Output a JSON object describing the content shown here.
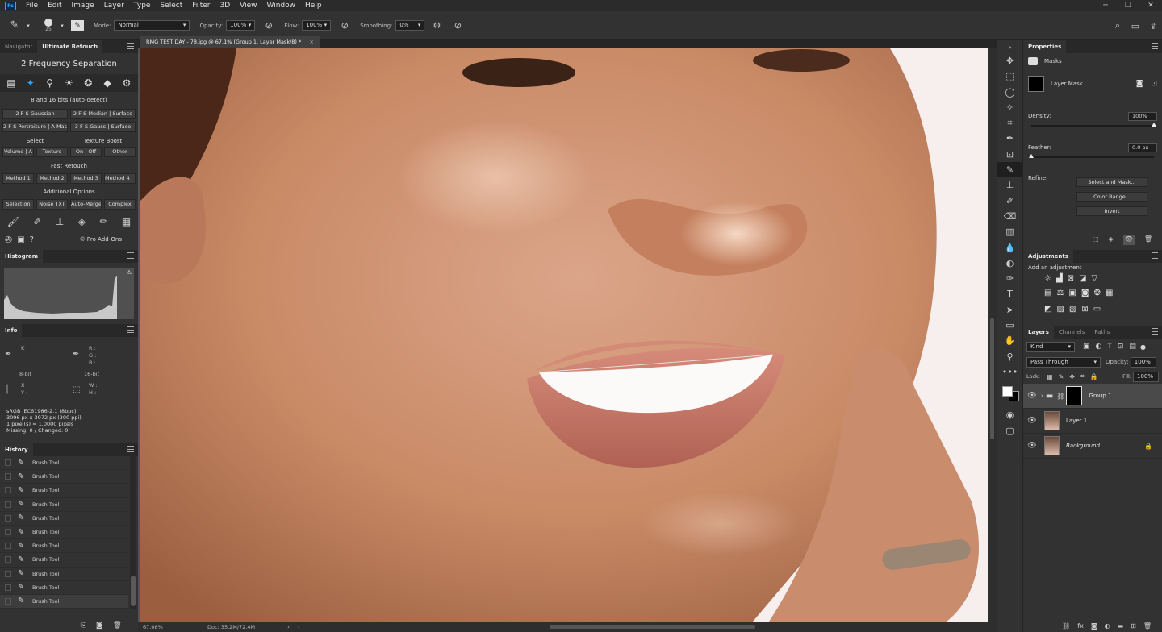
{
  "menubar": {
    "app_icon": "Ps",
    "items": [
      "File",
      "Edit",
      "Image",
      "Layer",
      "Type",
      "Select",
      "Filter",
      "3D",
      "View",
      "Window",
      "Help"
    ]
  },
  "options": {
    "brush_size": "25",
    "mode_label": "Mode:",
    "mode_value": "Normal",
    "opacity_label": "Opacity:",
    "opacity_value": "100%",
    "flow_label": "Flow:",
    "flow_value": "100%",
    "smoothing_label": "Smoothing:",
    "smoothing_value": "0%"
  },
  "left_panel": {
    "tabs": [
      "Navigator",
      "Ultimate Retouch"
    ],
    "ur_title": "2 Frequency Separation",
    "ur_subtitle": "8 and 16 bits (auto-detect)",
    "row1": [
      "2 F-S Gaussian",
      "2 F-S Median | Surface"
    ],
    "row2": [
      "2 F-S Portraiture | A-Mask",
      "3 F-S Gauss | Surface"
    ],
    "heads1": [
      "Select",
      "Texture Boost"
    ],
    "row3": [
      "Volume | A",
      "Texture",
      "On - Off",
      "Other"
    ],
    "head_fast": "Fast Retouch",
    "row4": [
      "Method 1",
      "Method 2",
      "Method 3",
      "Method 4 | A"
    ],
    "head_add": "Additional Options",
    "row5": [
      "Selection",
      "Noise TXT",
      "Auto-Merge",
      "Complex"
    ],
    "pro_addons": "© Pro Add-Ons",
    "histogram_tab": "Histogram",
    "info_tab": "Info",
    "info": {
      "k": "K :",
      "rgb": [
        "R :",
        "G :",
        "B :"
      ],
      "bit8": "8-bit",
      "bit16": "16-bit",
      "xy": [
        "X :",
        "Y :"
      ],
      "wh": [
        "W :",
        "H :"
      ],
      "lines": [
        "sRGB IEC61966-2.1 (8bpc)",
        "3096 px x 3972 px (300 ppi)",
        "1 pixel(s) = 1.0000 pixels",
        "Missing: 0 / Changed: 0"
      ]
    },
    "history_tab": "History",
    "history_items": [
      "Brush Tool",
      "Brush Tool",
      "Brush Tool",
      "Brush Tool",
      "Brush Tool",
      "Brush Tool",
      "Brush Tool",
      "Brush Tool",
      "Brush Tool",
      "Brush Tool",
      "Brush Tool"
    ]
  },
  "document": {
    "tab_title": "RMG TEST DAY - 78.jpg @ 67.1% (Group 1, Layer Mask/8) *",
    "close": "×",
    "zoom": "67.08%",
    "doc_size": "Doc: 35.2M/72.4M"
  },
  "properties": {
    "tab": "Properties",
    "masks_label": "Masks",
    "layer_mask_label": "Layer Mask",
    "density_label": "Density:",
    "density_value": "100%",
    "density_level": 1.0,
    "feather_label": "Feather:",
    "feather_value": "0.0 px",
    "feather_level": 0.0,
    "refine_label": "Refine:",
    "buttons": [
      "Select and Mask...",
      "Color Range...",
      "Invert"
    ]
  },
  "adjustments": {
    "tab": "Adjustments",
    "add_label": "Add an adjustment"
  },
  "layers": {
    "tabs": [
      "Layers",
      "Channels",
      "Paths"
    ],
    "kind": "Kind",
    "blend_mode": "Pass Through",
    "opacity_label": "Opacity:",
    "opacity_value": "100%",
    "lock_label": "Lock:",
    "fill_label": "Fill:",
    "fill_value": "100%",
    "items": [
      {
        "name": "Group 1"
      },
      {
        "name": "Layer 1"
      },
      {
        "name": "Background"
      }
    ]
  },
  "colors": {
    "accent": "#31a8ff",
    "panel_bg": "#323232",
    "dark_bg": "#262626"
  }
}
